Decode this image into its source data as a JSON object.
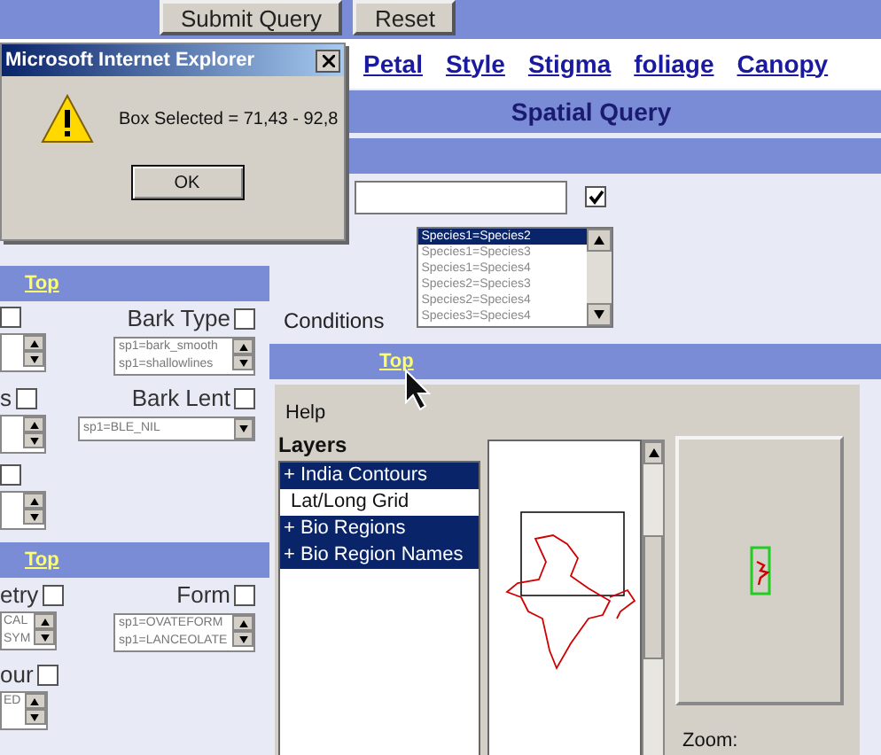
{
  "toolbar": {
    "buttons": [
      "Submit Query",
      "Reset"
    ]
  },
  "nav_links": [
    "Petal",
    "Style",
    "Stigma",
    "foliage",
    "Canopy"
  ],
  "section_title": "Spatial Query",
  "query_row": {
    "checked": true
  },
  "conditions": {
    "label": "Conditions",
    "options": [
      {
        "label": "Species1=Species2",
        "selected": true
      },
      {
        "label": "Species1=Species3",
        "selected": false
      },
      {
        "label": "Species1=Species4",
        "selected": false
      },
      {
        "label": "Species2=Species3",
        "selected": false
      },
      {
        "label": "Species2=Species4",
        "selected": false
      },
      {
        "label": "Species3=Species4",
        "selected": false
      }
    ]
  },
  "top_link": "Top",
  "left_panel": [
    {
      "kind": "top_link",
      "label": "Top"
    },
    {
      "kind": "field_row",
      "left": {
        "checked": false
      },
      "right": {
        "kind": "list",
        "label": "Bark Type",
        "checked": false,
        "options": [
          "sp1=bark_smooth",
          "sp1=shallowlines"
        ]
      }
    },
    {
      "kind": "field_row",
      "left": {
        "label": "s",
        "checked": false
      },
      "right": {
        "kind": "dropdown",
        "label": "Bark Lent",
        "checked": false,
        "options": [
          "sp1=BLE_NIL"
        ]
      }
    },
    {
      "kind": "field_row",
      "left": {
        "checked": false
      }
    },
    {
      "kind": "top_link",
      "label": "Top"
    },
    {
      "kind": "field_row",
      "left": {
        "label": "etry",
        "checked": false,
        "options": [
          "CAL",
          "SYM"
        ]
      },
      "right": {
        "kind": "list",
        "label": "Form",
        "checked": false,
        "options": [
          "sp1=OVATEFORM",
          "sp1=LANCEOLATE"
        ]
      }
    },
    {
      "kind": "field_row",
      "left": {
        "label": "our",
        "checked": false,
        "options": [
          "ED"
        ]
      }
    }
  ],
  "applet": {
    "help": "Help",
    "layers_title": "Layers",
    "layers": [
      {
        "label": "+ India Contours",
        "selected": true
      },
      {
        "label": "Lat/Long Grid",
        "selected": false
      },
      {
        "label": "+ Bio Regions",
        "selected": true
      },
      {
        "label": "+ Bio Region Names",
        "selected": true
      }
    ],
    "zoom_label": "Zoom:"
  },
  "dialog": {
    "title": "Microsoft Internet Explorer",
    "message": "Box Selected = 71,43 - 92,8",
    "button": "OK"
  }
}
